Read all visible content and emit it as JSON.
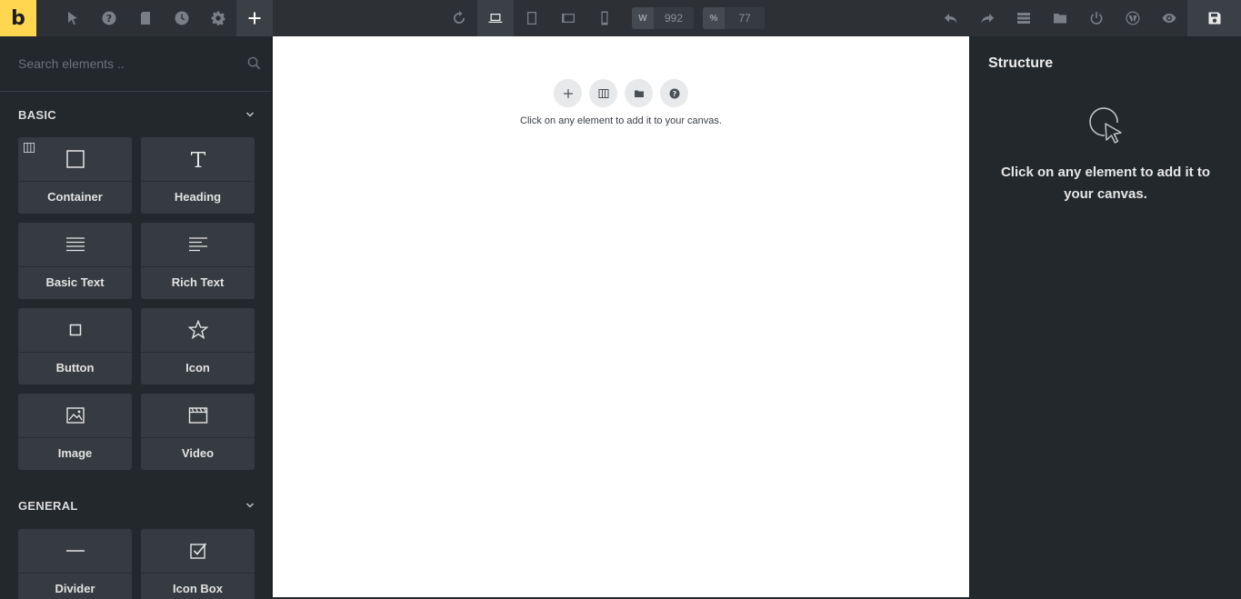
{
  "toolbar": {
    "logo": "b",
    "width_label": "W",
    "width_value": "992",
    "zoom_label": "%",
    "zoom_value": "77",
    "icons": [
      "cursor-icon",
      "help-icon",
      "page-icon",
      "history-icon",
      "settings-icon",
      "plus-icon",
      "reload-icon",
      "laptop-icon",
      "tablet-icon",
      "tablet-landscape-icon",
      "phone-icon",
      "undo-icon",
      "redo-icon",
      "layers-icon",
      "folder-icon",
      "power-icon",
      "wordpress-icon",
      "preview-icon",
      "save-icon"
    ]
  },
  "left_panel": {
    "search_placeholder": "Search elements ..",
    "sections": [
      {
        "title": "BASIC",
        "items": [
          {
            "label": "Container",
            "icon": "container-icon"
          },
          {
            "label": "Heading",
            "icon": "heading-icon"
          },
          {
            "label": "Basic Text",
            "icon": "basic-text-icon"
          },
          {
            "label": "Rich Text",
            "icon": "rich-text-icon"
          },
          {
            "label": "Button",
            "icon": "button-icon"
          },
          {
            "label": "Icon",
            "icon": "star-icon"
          },
          {
            "label": "Image",
            "icon": "image-icon"
          },
          {
            "label": "Video",
            "icon": "video-icon"
          }
        ]
      },
      {
        "title": "GENERAL",
        "items": [
          {
            "label": "Divider",
            "icon": "divider-icon"
          },
          {
            "label": "Icon Box",
            "icon": "icon-box-icon"
          }
        ]
      }
    ]
  },
  "canvas": {
    "hint": "Click on any element to add it to your canvas."
  },
  "right_panel": {
    "title": "Structure",
    "hint": "Click on any element to add it to your canvas."
  },
  "colors": {
    "accent": "#ffd64f",
    "panel_bg": "#23282d",
    "toolbar_bg": "#2d3136",
    "card_bg": "#363b41"
  }
}
